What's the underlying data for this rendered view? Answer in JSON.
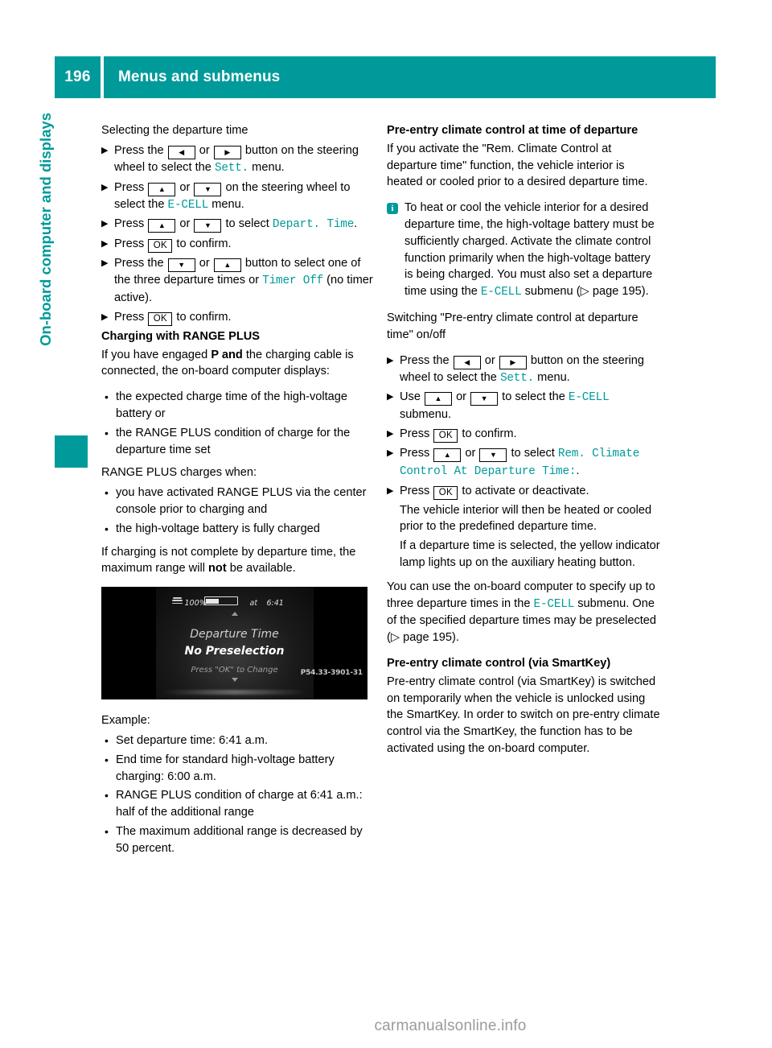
{
  "header": {
    "page_number": "196",
    "title": "Menus and submenus",
    "accent_color": "#009a9a"
  },
  "sidebar": {
    "chapter_label": "On-board computer and displays"
  },
  "left_column": {
    "heading": "Selecting the departure time",
    "steps": [
      {
        "parts": [
          {
            "t": "text",
            "v": "Press the "
          },
          {
            "t": "key",
            "v": "◀"
          },
          {
            "t": "text",
            "v": " or "
          },
          {
            "t": "key",
            "v": "▶"
          },
          {
            "t": "text",
            "v": " button on the steering wheel to select the "
          },
          {
            "t": "menu",
            "v": "Sett."
          },
          {
            "t": "text",
            "v": " menu."
          }
        ]
      },
      {
        "parts": [
          {
            "t": "text",
            "v": "Press "
          },
          {
            "t": "key",
            "v": "▲"
          },
          {
            "t": "text",
            "v": " or "
          },
          {
            "t": "key",
            "v": "▼"
          },
          {
            "t": "text",
            "v": " on the steering wheel to select the "
          },
          {
            "t": "menu",
            "v": "E-CELL"
          },
          {
            "t": "text",
            "v": " menu."
          }
        ]
      },
      {
        "parts": [
          {
            "t": "text",
            "v": "Press "
          },
          {
            "t": "key",
            "v": "▲"
          },
          {
            "t": "text",
            "v": " or "
          },
          {
            "t": "key",
            "v": "▼"
          },
          {
            "t": "text",
            "v": " to select "
          },
          {
            "t": "menu",
            "v": "Depart. Time"
          },
          {
            "t": "text",
            "v": "."
          }
        ]
      },
      {
        "parts": [
          {
            "t": "text",
            "v": "Press "
          },
          {
            "t": "keyok",
            "v": "OK"
          },
          {
            "t": "text",
            "v": " to confirm."
          }
        ]
      },
      {
        "parts": [
          {
            "t": "text",
            "v": "Press the "
          },
          {
            "t": "key",
            "v": "▼"
          },
          {
            "t": "text",
            "v": " or "
          },
          {
            "t": "key",
            "v": "▲"
          },
          {
            "t": "text",
            "v": " button to select one of the three departure times or "
          },
          {
            "t": "menu",
            "v": "Timer Off"
          },
          {
            "t": "text",
            "v": " (no timer active)."
          }
        ]
      },
      {
        "parts": [
          {
            "t": "text",
            "v": "Press "
          },
          {
            "t": "keyok",
            "v": "OK"
          },
          {
            "t": "text",
            "v": " to confirm."
          }
        ]
      }
    ],
    "charging_heading": "Charging with RANGE PLUS",
    "charging_intro": [
      {
        "t": "text",
        "v": "If you have engaged "
      },
      {
        "t": "bold",
        "v": "P and"
      },
      {
        "t": "text",
        "v": " the charging cable is connected, the on-board computer displays:"
      }
    ],
    "display_bullets": [
      "the expected charge time of the high-voltage battery or",
      "the RANGE PLUS condition of charge for the departure time set"
    ],
    "charges_when_intro": "RANGE PLUS charges when:",
    "charges_when_bullets": [
      "you have activated RANGE PLUS via the center console prior to charging and",
      "the high-voltage battery is fully charged"
    ],
    "incomplete_note": [
      {
        "t": "text",
        "v": "If charging is not complete by departure time, the maximum range will "
      },
      {
        "t": "bold",
        "v": "not"
      },
      {
        "t": "text",
        "v": " be available."
      }
    ],
    "display_photo": {
      "battery_icon": "charging-plug-icon",
      "percent": "100%",
      "battery_fill_percent": 38,
      "at_label": "at",
      "time": "6:41",
      "line1": "Departure Time",
      "line2": "No Preselection",
      "line3": "Press \"OK\" to Change",
      "figure_code": "P54.33-3901-31",
      "scroll_up": "up-arrow-icon",
      "scroll_down": "down-arrow-icon"
    },
    "example_label": "Example:",
    "example_bullets": [
      "Set departure time: 6:41 a.m.",
      "End time for standard high-voltage battery charging: 6:00 a.m.",
      "RANGE PLUS condition of charge at 6:41 a.m.: half of the additional range",
      "The maximum additional range is decreased by 50 percent."
    ]
  },
  "right_column": {
    "heading1": "Pre-entry climate control at time of departure",
    "intro1": "If you activate the \"Rem. Climate Control at departure time\" function, the vehicle interior is heated or cooled prior to a desired departure time.",
    "note": {
      "icon": "info-icon",
      "parts": [
        {
          "t": "text",
          "v": "To heat or cool the vehicle interior for a desired departure time, the high-voltage battery must be sufficiently charged. Activate the climate control function primarily when the high-voltage battery is being charged. You must also set a departure time using the "
        },
        {
          "t": "menu",
          "v": "E-CELL"
        },
        {
          "t": "text",
          "v": " submenu ("
        },
        {
          "t": "pageref",
          "v": "▷ page 195"
        },
        {
          "t": "text",
          "v": ")."
        }
      ]
    },
    "heading2": "Switching \"Pre-entry climate control at departure time\" on/off",
    "steps": [
      {
        "parts": [
          {
            "t": "text",
            "v": "Press the "
          },
          {
            "t": "key",
            "v": "◀"
          },
          {
            "t": "text",
            "v": " or "
          },
          {
            "t": "key",
            "v": "▶"
          },
          {
            "t": "text",
            "v": " button on the steering wheel to select the "
          },
          {
            "t": "menu",
            "v": "Sett."
          },
          {
            "t": "text",
            "v": " menu."
          }
        ]
      },
      {
        "parts": [
          {
            "t": "text",
            "v": "Use "
          },
          {
            "t": "key",
            "v": "▲"
          },
          {
            "t": "text",
            "v": " or "
          },
          {
            "t": "key",
            "v": "▼"
          },
          {
            "t": "text",
            "v": " to select the "
          },
          {
            "t": "menu",
            "v": "E-CELL"
          },
          {
            "t": "text",
            "v": " submenu."
          }
        ]
      },
      {
        "parts": [
          {
            "t": "text",
            "v": "Press "
          },
          {
            "t": "keyok",
            "v": "OK"
          },
          {
            "t": "text",
            "v": " to confirm."
          }
        ]
      },
      {
        "parts": [
          {
            "t": "text",
            "v": "Press "
          },
          {
            "t": "key",
            "v": "▲"
          },
          {
            "t": "text",
            "v": " or "
          },
          {
            "t": "key",
            "v": "▼"
          },
          {
            "t": "text",
            "v": " to select "
          },
          {
            "t": "menu",
            "v": "Rem. Climate Control At Departure Time:"
          },
          {
            "t": "text",
            "v": "."
          }
        ]
      },
      {
        "parts": [
          {
            "t": "text",
            "v": "Press "
          },
          {
            "t": "keyok",
            "v": "OK"
          },
          {
            "t": "text",
            "v": " to activate or deactivate."
          }
        ],
        "sub": [
          "The vehicle interior will then be heated or cooled prior to the predefined departure time.",
          "If a departure time is selected, the yellow indicator lamp lights up on the auxiliary heating button."
        ]
      }
    ],
    "specify_note": [
      {
        "t": "text",
        "v": "You can use the on-board computer to specify up to three departure times in the "
      },
      {
        "t": "menu",
        "v": "E-CELL"
      },
      {
        "t": "text",
        "v": " submenu. One of the specified departure times may be preselected ("
      },
      {
        "t": "pageref",
        "v": "▷ page 195"
      },
      {
        "t": "text",
        "v": ")."
      }
    ],
    "heading3": "Pre-entry climate control (via SmartKey)",
    "intro3": "Pre-entry climate control (via SmartKey) is switched on temporarily when the vehicle is unlocked using the SmartKey. In order to switch on pre-entry climate control via the SmartKey, the function has to be activated using the on-board computer."
  },
  "footer": {
    "watermark": "carmanualsonline.info"
  }
}
